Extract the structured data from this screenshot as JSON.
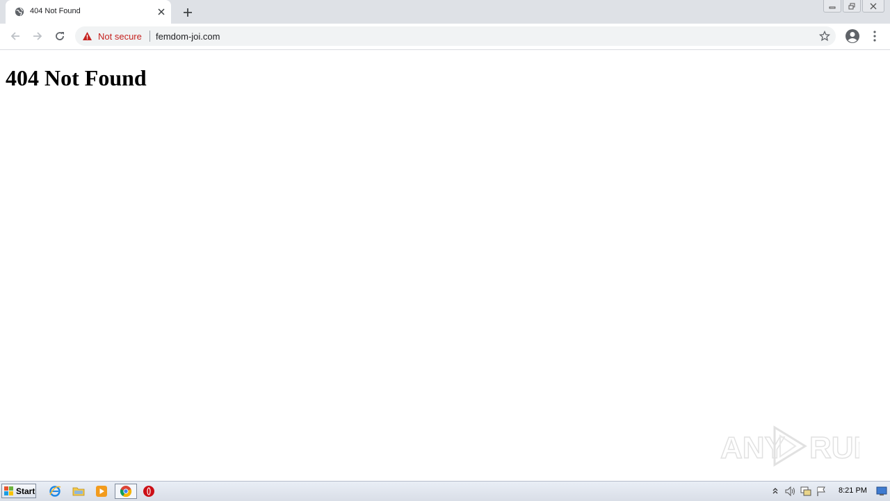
{
  "browser": {
    "tab": {
      "title": "404 Not Found",
      "favicon": "globe-icon",
      "close_icon": "close-icon"
    },
    "new_tab_icon": "plus-icon",
    "window_controls": [
      "minimize-icon",
      "restore-icon",
      "close-icon"
    ],
    "toolbar": {
      "back_icon": "arrow-left-icon",
      "forward_icon": "arrow-right-icon",
      "reload_icon": "reload-icon",
      "security_warning_icon": "warning-triangle-icon",
      "security_label": "Not secure",
      "url": "femdom-joi.com",
      "bookmark_icon": "star-icon",
      "profile_icon": "account-circle-icon",
      "menu_icon": "kebab-menu-icon"
    },
    "colors": {
      "tabstrip": "#dee1e6",
      "omnibox": "#f1f3f4",
      "not_secure": "#c5221f"
    }
  },
  "page": {
    "heading": "404 Not Found"
  },
  "watermark": {
    "text": "ANY RUN"
  },
  "taskbar": {
    "start_label": "Start",
    "pinned": [
      "internet-explorer-icon",
      "folder-icon",
      "media-player-icon",
      "chrome-icon",
      "opera-icon"
    ],
    "active_app": "chrome-icon",
    "tray_icons": [
      "show-hidden-icons-icon",
      "volume-icon",
      "network-icon",
      "action-center-flag-icon"
    ],
    "clock": "8:21 PM",
    "show_desktop_icon": "show-desktop-icon"
  }
}
